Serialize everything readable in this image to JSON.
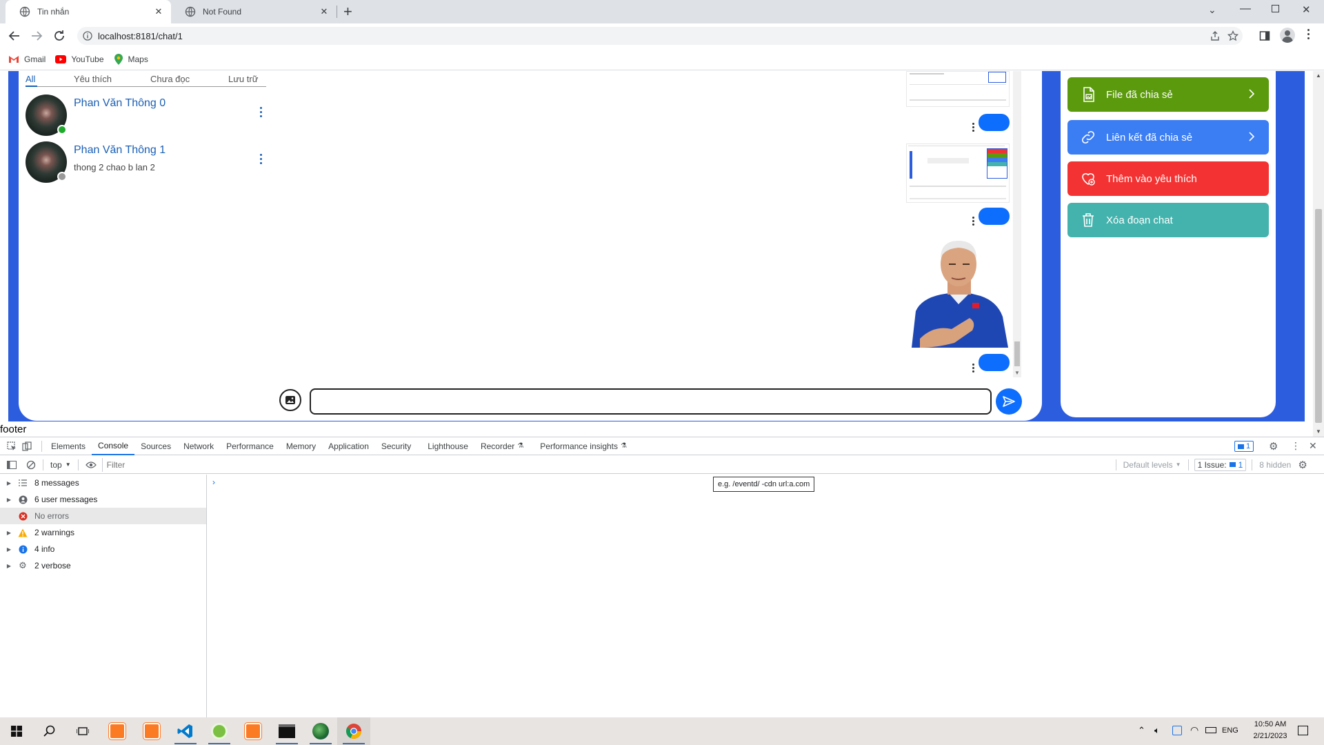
{
  "browser": {
    "tabs": [
      {
        "title": "Tin nhắn",
        "active": true
      },
      {
        "title": "Not Found",
        "active": false
      }
    ],
    "new_tab": "+",
    "url": "localhost:8181/chat/1",
    "bookmarks": [
      "Gmail",
      "YouTube",
      "Maps"
    ]
  },
  "chat": {
    "filter_tabs": [
      "All",
      "Yêu thích",
      "Chưa đọc",
      "Lưu trữ"
    ],
    "active_filter": "All",
    "contacts": [
      {
        "name": "Phan Văn Thông 0",
        "last_message": "",
        "online": true
      },
      {
        "name": "Phan Văn Thông 1",
        "last_message": "thong 2 chao b lan 2",
        "online": false
      }
    ],
    "message_input": {
      "value": "",
      "placeholder": ""
    }
  },
  "side_panel": {
    "buttons": [
      {
        "label": "File đã chia sẻ",
        "color": "#5b9a0c",
        "icon": "file-image-icon",
        "chevron": true
      },
      {
        "label": "Liên kết đã chia sẻ",
        "color": "#3b7df2",
        "icon": "link-icon",
        "chevron": true
      },
      {
        "label": "Thêm vào yêu thích",
        "color": "#f33333",
        "icon": "heart-icon",
        "chevron": false
      },
      {
        "label": "Xóa đoạn chat",
        "color": "#44b3ad",
        "icon": "trash-icon",
        "chevron": false
      }
    ]
  },
  "footer_text": "footer",
  "devtools": {
    "tabs": [
      "Elements",
      "Console",
      "Sources",
      "Network",
      "Performance",
      "Memory",
      "Application",
      "Security",
      "Lighthouse",
      "Recorder",
      "Performance insights"
    ],
    "active_tab": "Console",
    "issues_badge": "1",
    "context": "top",
    "filter_placeholder": "Filter",
    "default_levels": "Default levels",
    "issues_label": "1 Issue:",
    "issues_count": "1",
    "hidden_label": "8 hidden",
    "sidebar": [
      {
        "label": "8 messages",
        "icon": "list-icon"
      },
      {
        "label": "6 user messages",
        "icon": "user-icon"
      },
      {
        "label": "No errors",
        "icon": "error-icon",
        "selected": true
      },
      {
        "label": "2 warnings",
        "icon": "warning-icon"
      },
      {
        "label": "4 info",
        "icon": "info-icon"
      },
      {
        "label": "2 verbose",
        "icon": "verbose-icon"
      }
    ],
    "tooltip": "e.g. /eventd/ -cdn url:a.com"
  },
  "taskbar": {
    "language": "ENG",
    "time": "10:50 AM",
    "date": "2/21/2023"
  }
}
